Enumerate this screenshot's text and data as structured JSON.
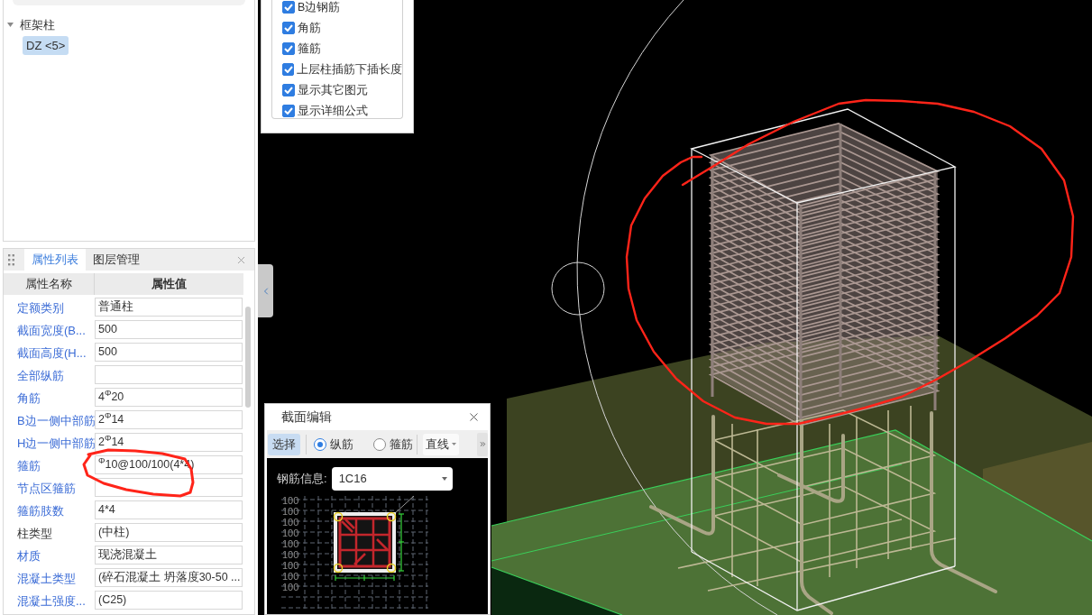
{
  "tree": {
    "items": [
      {
        "label": "框架柱",
        "expanded": true,
        "selected": false,
        "children": [
          {
            "label": "DZ <5>",
            "selected": true
          }
        ]
      }
    ]
  },
  "properties": {
    "tabs": [
      {
        "label": "属性列表",
        "selected": true
      },
      {
        "label": "图层管理",
        "selected": false
      }
    ],
    "columns": [
      "属性名称",
      "属性值"
    ],
    "rows": [
      {
        "name": "定额类别",
        "value": "普通柱",
        "kind": "public"
      },
      {
        "name": "截面宽度(B...",
        "value": "500",
        "kind": "public"
      },
      {
        "name": "截面高度(H...",
        "value": "500",
        "kind": "public"
      },
      {
        "name": "全部纵筋",
        "kind": "public"
      },
      {
        "name": "角筋",
        "value": "4$^{Φ}$20",
        "kind": "public"
      },
      {
        "name": "B边一侧中部筋",
        "value": "2$^{Φ}$14",
        "kind": "public"
      },
      {
        "name": "H边一侧中部筋",
        "value": "2$^{Φ}$14",
        "kind": "public"
      },
      {
        "name": "箍筋",
        "value": "$^{Φ}$10@100/100(4*4)",
        "kind": "public"
      },
      {
        "name": "节点区箍筋",
        "kind": "public"
      },
      {
        "name": "箍筋肢数",
        "value": "4*4",
        "kind": "public"
      },
      {
        "name": "柱类型",
        "value": "(中柱)",
        "kind": "private"
      },
      {
        "name": "材质",
        "value": "现浇混凝土",
        "kind": "public"
      },
      {
        "name": "混凝土类型",
        "value": "(碎石混凝土 坍落度30-50 ...",
        "kind": "public"
      },
      {
        "name": "混凝土强度...",
        "value": "(C25)",
        "kind": "public"
      }
    ]
  },
  "display_options": {
    "items": [
      {
        "label": "B边钢筋",
        "checked": true
      },
      {
        "label": "角筋",
        "checked": true
      },
      {
        "label": "箍筋",
        "checked": true
      },
      {
        "label": "上层柱插筋下插长度",
        "checked": true
      },
      {
        "label": "显示其它图元",
        "checked": true
      },
      {
        "label": "显示详细公式",
        "checked": true
      }
    ]
  },
  "section_editor": {
    "title": "截面编辑",
    "mode_button": {
      "label": "选择",
      "selected": true
    },
    "bar_types": [
      {
        "label": "纵筋",
        "selected": true
      },
      {
        "label": "箍筋",
        "selected": false
      }
    ],
    "line_type": "直线",
    "rebar_info": {
      "label": "钢筋信息:",
      "value": "1C16"
    },
    "axis_labels": [
      "100",
      "100",
      "100",
      "100",
      "100",
      "100",
      "100",
      "100",
      "100"
    ]
  }
}
